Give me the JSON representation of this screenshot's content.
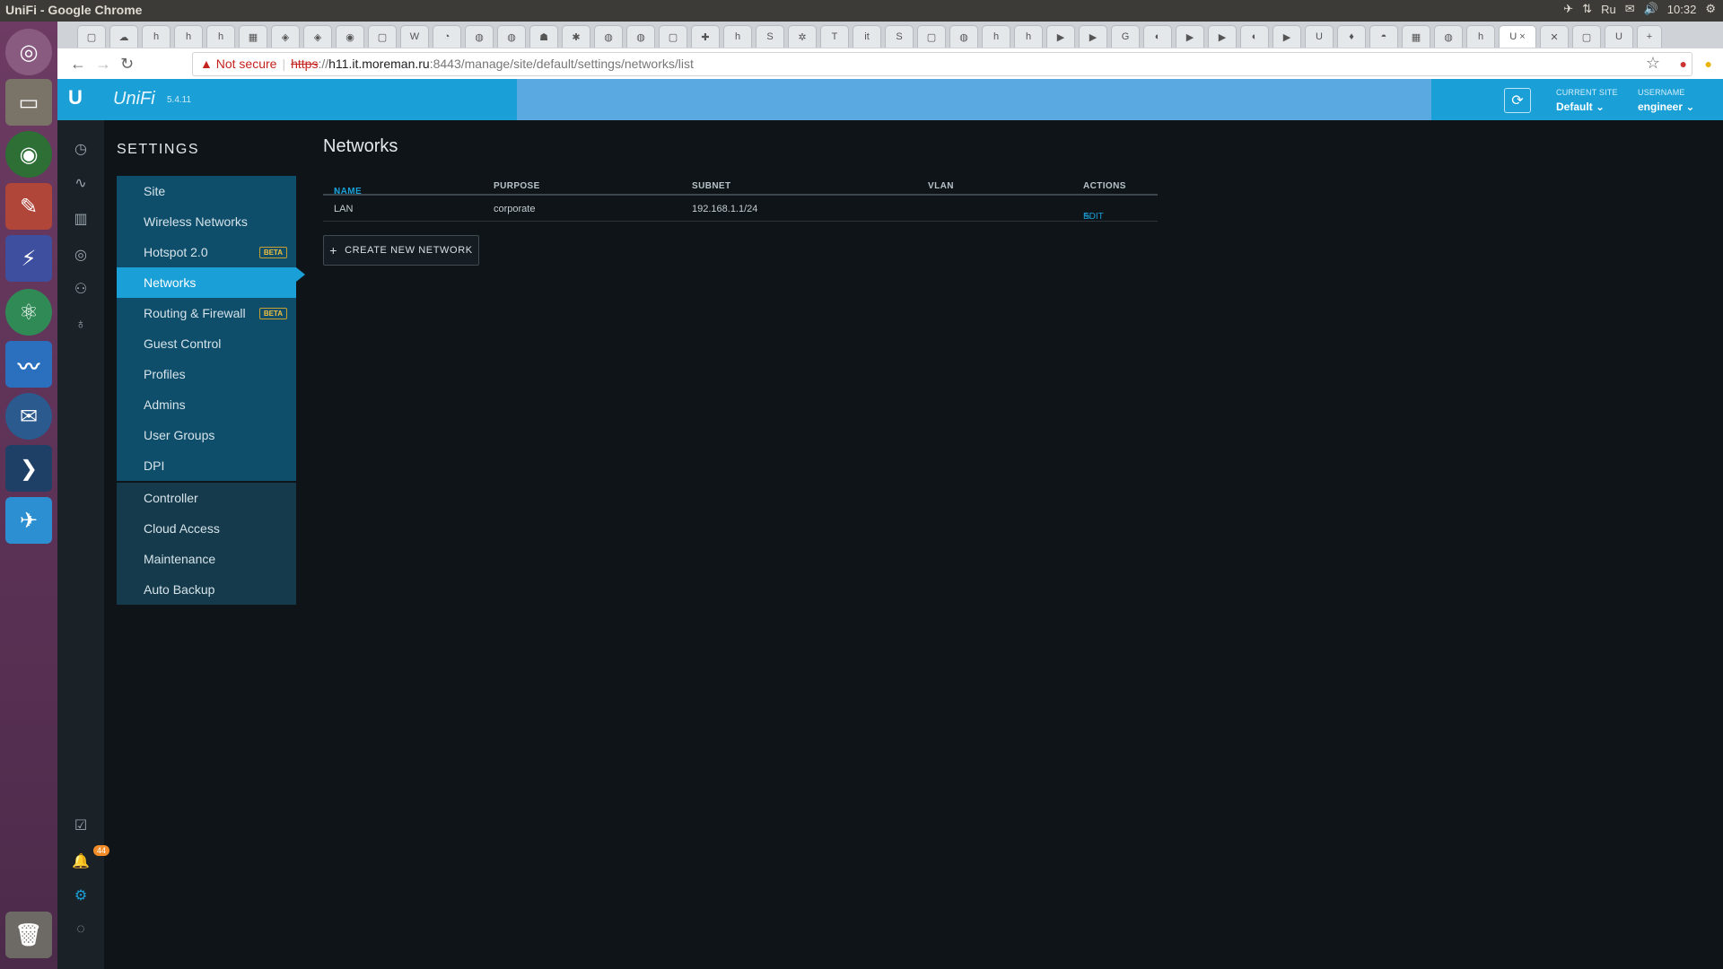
{
  "window": {
    "title": "UniFi - Google Chrome"
  },
  "system_tray": {
    "language": "Ru",
    "time": "10:32"
  },
  "browser": {
    "security_label": "Not secure",
    "url_scheme": "https",
    "url_separator": "://",
    "url_host": "h11.it.moreman.ru",
    "url_path": ":8443/manage/site/default/settings/networks/list"
  },
  "header": {
    "logo_word": "UniFi",
    "version": "5.4.11",
    "current_site_label": "CURRENT SITE",
    "current_site_value": "Default",
    "username_label": "USERNAME",
    "username_value": "engineer"
  },
  "rail": {
    "notification_count": "44"
  },
  "settings": {
    "title": "SETTINGS",
    "primary_items": [
      {
        "label": "Site"
      },
      {
        "label": "Wireless Networks"
      },
      {
        "label": "Hotspot 2.0",
        "badge": "BETA"
      },
      {
        "label": "Networks"
      },
      {
        "label": "Routing & Firewall",
        "badge": "BETA"
      },
      {
        "label": "Guest Control"
      },
      {
        "label": "Profiles"
      },
      {
        "label": "Admins"
      },
      {
        "label": "User Groups"
      },
      {
        "label": "DPI"
      }
    ],
    "secondary_items": [
      {
        "label": "Controller"
      },
      {
        "label": "Cloud Access"
      },
      {
        "label": "Maintenance"
      },
      {
        "label": "Auto Backup"
      }
    ]
  },
  "main": {
    "title": "Networks",
    "columns": {
      "name": "NAME",
      "sort_arrow": "↑",
      "purpose": "PURPOSE",
      "subnet": "SUBNET",
      "vlan": "VLAN",
      "actions": "ACTIONS"
    },
    "rows": [
      {
        "name": "LAN",
        "purpose": "corporate",
        "subnet": "192.168.1.1/24",
        "vlan": "",
        "action": "EDIT"
      }
    ],
    "create_button": "CREATE NEW NETWORK"
  }
}
